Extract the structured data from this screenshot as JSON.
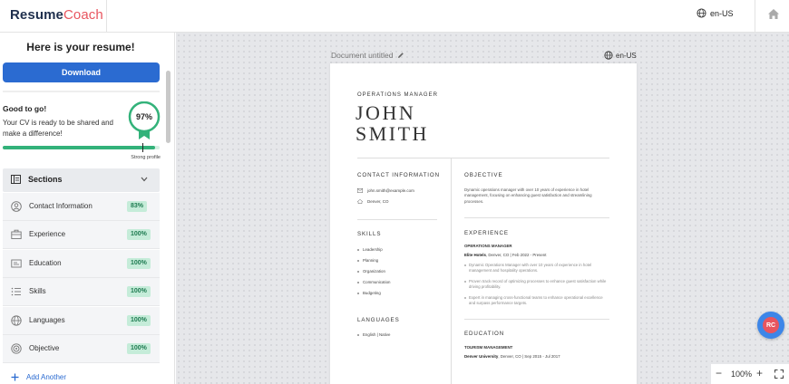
{
  "app": {
    "logo_part1": "Resume",
    "logo_part2": "Coach",
    "language": "en-US"
  },
  "sidebar": {
    "title": "Here is your resume!",
    "download_label": "Download",
    "status_title": "Good to go!",
    "status_text": "Your CV is ready to be shared and make a difference!",
    "score": "97%",
    "score_value": 97,
    "profile_label": "Strong profile",
    "sections_label": "Sections",
    "sections": [
      {
        "name": "Contact Information",
        "badge": "83%",
        "icon": "user-circle-icon"
      },
      {
        "name": "Experience",
        "badge": "100%",
        "icon": "briefcase-icon"
      },
      {
        "name": "Education",
        "badge": "100%",
        "icon": "graduation-icon"
      },
      {
        "name": "Skills",
        "badge": "100%",
        "icon": "list-icon"
      },
      {
        "name": "Languages",
        "badge": "100%",
        "icon": "globe-icon"
      },
      {
        "name": "Objective",
        "badge": "100%",
        "icon": "target-icon"
      }
    ],
    "add_another": "Add Another"
  },
  "document": {
    "name": "Document untitled",
    "language": "en-US",
    "job_title": "OPERATIONS MANAGER",
    "first_name": "JOHN",
    "last_name": "SMITH",
    "contact_heading": "CONTACT INFORMATION",
    "email": "john.smith@example.com",
    "location": "Denver, CO",
    "skills_heading": "SKILLS",
    "skills": [
      "Leadership",
      "Planning",
      "Organization",
      "Communication",
      "Budgeting"
    ],
    "languages_heading": "LANGUAGES",
    "languages": [
      "English | Native"
    ],
    "objective_heading": "OBJECTIVE",
    "objective_text": "Dynamic operations manager with over 10 years of experience in hotel management, focusing on enhancing guest satisfaction and streamlining processes.",
    "experience_heading": "EXPERIENCE",
    "exp_title": "OPERATIONS MANAGER",
    "exp_company": "Elite Hotels",
    "exp_meta": ", Denver, CO | Feb 2022 - Present",
    "exp_bullets": [
      "Dynamic Operations Manager with over 10 years of experience in hotel management and hospitality operations.",
      "Proven track record of optimizing processes to enhance guest satisfaction while driving profitability.",
      "Expert in managing cross-functional teams to enhance operational excellence and surpass performance targets."
    ],
    "education_heading": "EDUCATION",
    "edu_title": "TOURISM MANAGEMENT",
    "edu_school": "Denver University",
    "edu_meta": ", Denver, CO | Sep 2015 - Jul 2017"
  },
  "zoom": {
    "value": "100%",
    "minus": "−",
    "plus": "+"
  },
  "user_badge": "RC",
  "colors": {
    "primary": "#2b6bd1",
    "accent": "#e8555f",
    "success": "#33b27a",
    "badge_bg": "#c5ecd9"
  }
}
